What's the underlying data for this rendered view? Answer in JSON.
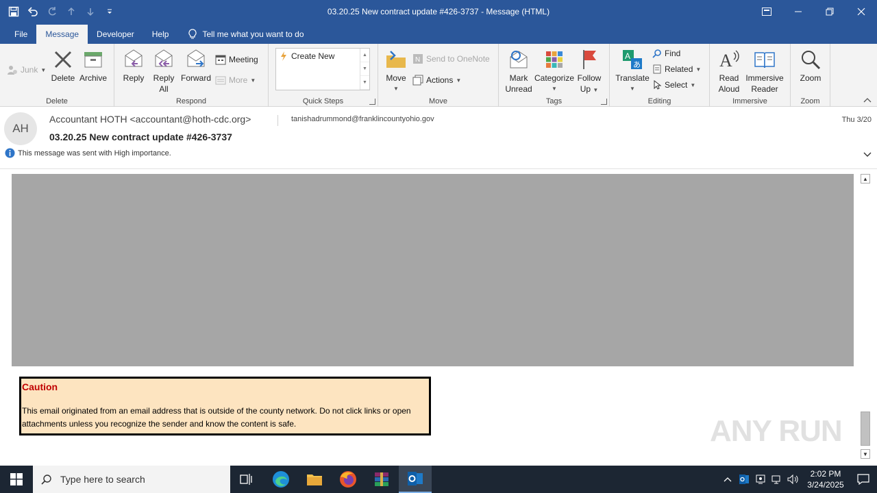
{
  "window": {
    "title": "03.20.25 New contract update #426-3737  -  Message (HTML)"
  },
  "tabs": [
    {
      "label": "File"
    },
    {
      "label": "Message"
    },
    {
      "label": "Developer"
    },
    {
      "label": "Help"
    }
  ],
  "tell_me": "Tell me what you want to do",
  "ribbon": {
    "delete_group": {
      "label": "Delete",
      "junk": "Junk",
      "delete": "Delete",
      "archive": "Archive"
    },
    "respond_group": {
      "label": "Respond",
      "reply": "Reply",
      "reply_all_1": "Reply",
      "reply_all_2": "All",
      "forward": "Forward",
      "meeting": "Meeting",
      "more": "More"
    },
    "quicksteps_group": {
      "label": "Quick Steps",
      "create_new": "Create New"
    },
    "move_group": {
      "label": "Move",
      "move": "Move",
      "onenote": "Send to OneNote",
      "actions": "Actions"
    },
    "tags_group": {
      "label": "Tags",
      "mark_1": "Mark",
      "mark_2": "Unread",
      "categorize": "Categorize",
      "follow_1": "Follow",
      "follow_2": "Up"
    },
    "editing_group": {
      "label": "Editing",
      "translate": "Translate",
      "find": "Find",
      "related": "Related",
      "select": "Select"
    },
    "immersive_group": {
      "label": "Immersive",
      "read_1": "Read",
      "read_2": "Aloud",
      "immersive_1": "Immersive",
      "immersive_2": "Reader"
    },
    "zoom_group": {
      "label": "Zoom",
      "zoom": "Zoom"
    }
  },
  "message": {
    "avatar_initials": "AH",
    "sender": "Accountant HOTH <accountant@hoth-cdc.org>",
    "recipient": "tanishadrummond@franklincountyohio.gov",
    "date": "Thu 3/20",
    "subject": "03.20.25 New contract update #426-3737",
    "importance": "This message was sent with High importance."
  },
  "caution": {
    "title": "Caution",
    "text": "This email originated from an email address that is outside of the county network. Do not click links or open attachments unless you recognize the sender and know the content is safe."
  },
  "watermark": "ANY RUN",
  "taskbar": {
    "search_placeholder": "Type here to search",
    "time": "2:02 PM",
    "date": "3/24/2025"
  },
  "colors": {
    "brand": "#2b579a",
    "caution_bg": "#fde4c0",
    "caution_title": "#c00000"
  }
}
